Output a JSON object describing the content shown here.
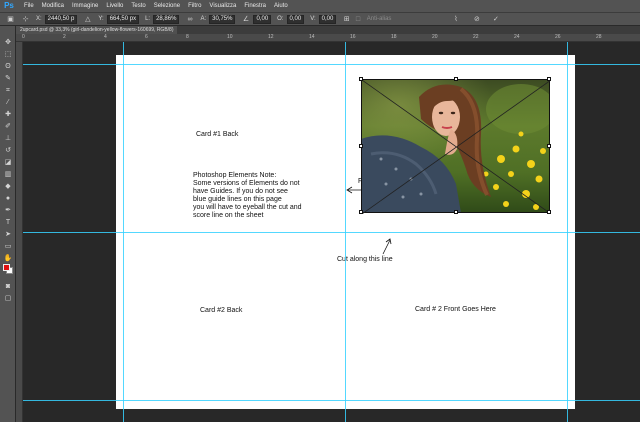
{
  "app": {
    "logo": "Ps"
  },
  "menu": [
    "File",
    "Modifica",
    "Immagine",
    "Livello",
    "Testo",
    "Selezione",
    "Filtro",
    "Visualizza",
    "Finestra",
    "Aiuto"
  ],
  "options": {
    "x_label": "X:",
    "x_value": "2440,50 p",
    "y_label": "Y:",
    "y_value": "664,50 px",
    "w_label": "L:",
    "w_value": "28,86%",
    "h_label": "A:",
    "h_value": "30,75%",
    "angle_value": "0,00",
    "h_skew_label": "O:",
    "h_skew_value": "0,00",
    "v_skew_label": "V:",
    "v_skew_value": "0,00",
    "antialias_label": "Anti-alias"
  },
  "document": {
    "tab_title": "2upcard.psd @ 33,3% (girl-dandelion-yellow-flowers-160699, RGB/8)"
  },
  "ruler": {
    "marks": [
      "0",
      "2",
      "4",
      "6",
      "8",
      "10",
      "12",
      "14",
      "16",
      "18",
      "20",
      "22",
      "24",
      "26",
      "28"
    ]
  },
  "swatches": {
    "foreground": "#e01010",
    "background": "#ffffff"
  },
  "guide_color": "#36d1ff",
  "page": {
    "card1_label": "Card #1 Back",
    "card2_label": "Card #2 Back",
    "card2_front_label": "Card # 2 Front Goes Here",
    "cut_label": "Cut along this line",
    "note_lines": [
      "Photoshop Elements Note:",
      "Some versions of Elements do not",
      "have Guides.  If you do not see",
      "blue guide lines on this page",
      "you will have to eyeball the cut and",
      "score line on the sheet"
    ],
    "partial_text": "F"
  }
}
